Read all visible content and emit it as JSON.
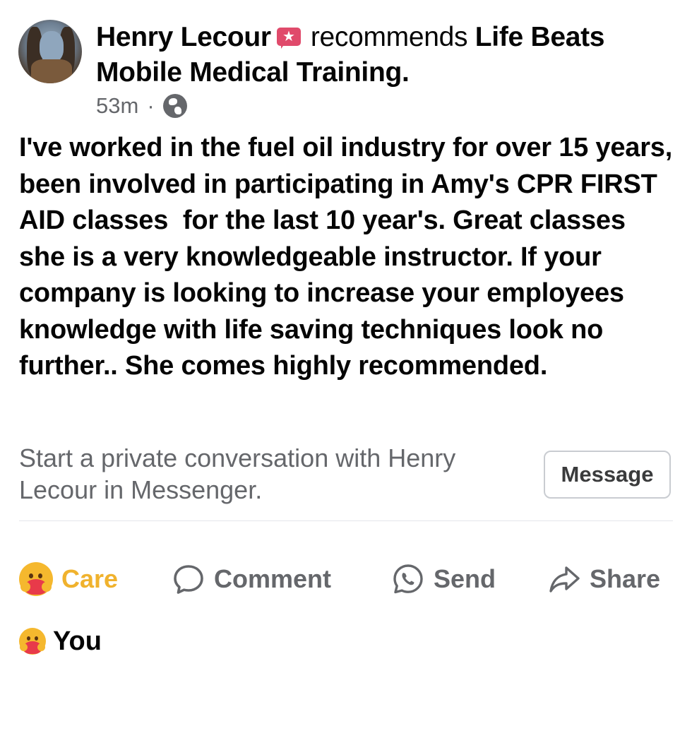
{
  "post": {
    "author": "Henry Lecour",
    "action_text": "recommends",
    "page_name": "Life Beats Mobile Medical Training",
    "title_end": ".",
    "timestamp": "53m",
    "separator": "·",
    "privacy_icon": "globe-icon",
    "body": "I've worked in the fuel oil industry for over 15 years, been involved in participating in Amy's CPR FIRST AID classes  for the last 10 year's. Great classes she is a very knowledgeable instructor. If your company is looking to increase your employees knowledge with life saving techniques look no further.. She comes highly recommended."
  },
  "messenger": {
    "prompt": "Start a private conversation with Henry Lecour in Messenger.",
    "button_label": "Message"
  },
  "actions": {
    "care": "Care",
    "comment": "Comment",
    "send": "Send",
    "share": "Share"
  },
  "reactions": {
    "reactor": "You"
  },
  "colors": {
    "care_accent": "#f0b22d",
    "secondary_text": "#65676b",
    "recommend_badge": "#e04a6b"
  }
}
